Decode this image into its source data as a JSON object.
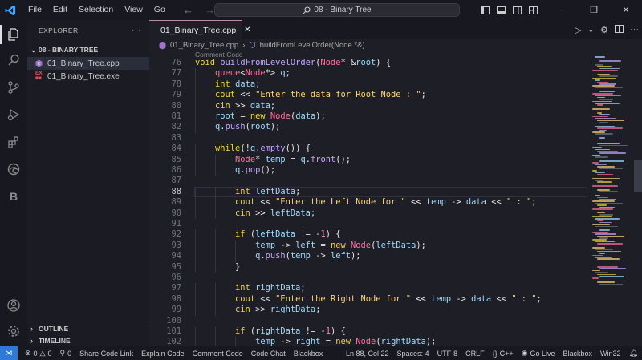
{
  "titlebar": {
    "menu": [
      "File",
      "Edit",
      "Selection",
      "View",
      "Go"
    ],
    "search_text": "08 - Binary Tree"
  },
  "sidebar": {
    "header": "EXPLORER",
    "folder": "08 - BINARY TREE",
    "files": [
      {
        "name": "01_Binary_Tree.cpp",
        "badge": "C",
        "badge_color": "#a074c4"
      },
      {
        "name": "01_Binary_Tree.exe",
        "badge": "EX",
        "badge_color": "#e05252"
      }
    ],
    "outline": "OUTLINE",
    "timeline": "TIMELINE"
  },
  "editor": {
    "tab_label": "01_Binary_Tree.cpp",
    "breadcrumb_file": "01_Binary_Tree.cpp",
    "breadcrumb_symbol": "buildFromLevelOrder(Node *&)",
    "codelens": "Comment Code",
    "current_line": 88,
    "lines": [
      {
        "n": "76",
        "t": "void buildFromLevelOrder(Node* &root) {"
      },
      {
        "n": "77",
        "t": "    queue<Node*> q;"
      },
      {
        "n": "78",
        "t": "    int data;"
      },
      {
        "n": "79",
        "t": "    cout << \"Enter the data for Root Node : \";"
      },
      {
        "n": "80",
        "t": "    cin >> data;"
      },
      {
        "n": "81",
        "t": "    root = new Node(data);"
      },
      {
        "n": "82",
        "t": "    q.push(root);"
      },
      {
        "n": "83",
        "t": ""
      },
      {
        "n": "84",
        "t": "    while(!q.empty()) {"
      },
      {
        "n": "85",
        "t": "        Node* temp = q.front();"
      },
      {
        "n": "86",
        "t": "        q.pop();"
      },
      {
        "n": "87",
        "t": ""
      },
      {
        "n": "88",
        "t": "        int leftData;"
      },
      {
        "n": "89",
        "t": "        cout << \"Enter the Left Node for \" << temp -> data << \" : \";"
      },
      {
        "n": "90",
        "t": "        cin >> leftData;"
      },
      {
        "n": "91",
        "t": ""
      },
      {
        "n": "92",
        "t": "        if (leftData != -1) {"
      },
      {
        "n": "93",
        "t": "            temp -> left = new Node(leftData);"
      },
      {
        "n": "94",
        "t": "            q.push(temp -> left);"
      },
      {
        "n": "95",
        "t": "        }"
      },
      {
        "n": "96",
        "t": ""
      },
      {
        "n": "97",
        "t": "        int rightData;"
      },
      {
        "n": "98",
        "t": "        cout << \"Enter the Right Node for \" << temp -> data << \" : \";"
      },
      {
        "n": "99",
        "t": "        cin >> rightData;"
      },
      {
        "n": "100",
        "t": ""
      },
      {
        "n": "101",
        "t": "        if (rightData != -1) {"
      },
      {
        "n": "102",
        "t": "            temp -> right = new Node(rightData);"
      }
    ]
  },
  "statusbar": {
    "problems": "0",
    "warnings": "0",
    "ports": "0",
    "left_items": [
      "Share Code Link",
      "Explain Code",
      "Comment Code",
      "Code Chat",
      "Blackbox"
    ],
    "position": "Ln 88, Col 22",
    "spaces": "Spaces: 4",
    "encoding": "UTF-8",
    "eol": "CRLF",
    "language": "C++",
    "golive": "Go Live",
    "blackbox": "Blackbox",
    "platform": "Win32"
  },
  "colors": {
    "accent": "#2f7ad8",
    "keyword": "#f0d52f",
    "type": "#ff6e9c",
    "string": "#ffd479"
  }
}
